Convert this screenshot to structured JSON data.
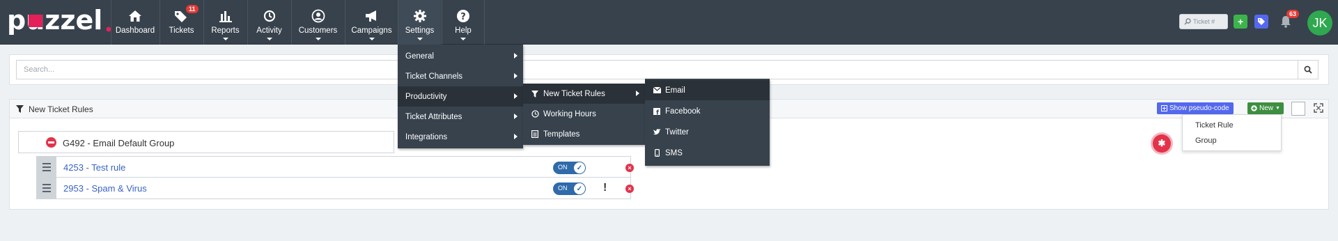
{
  "app": {
    "logo_text": "puzzel"
  },
  "nav": {
    "items": [
      {
        "label": "Dashboard",
        "icon": "home-icon"
      },
      {
        "label": "Tickets",
        "icon": "tags-icon",
        "badge": "11"
      },
      {
        "label": "Reports",
        "icon": "bar-chart-icon"
      },
      {
        "label": "Activity",
        "icon": "history-icon"
      },
      {
        "label": "Customers",
        "icon": "user-circle-icon"
      },
      {
        "label": "Campaigns",
        "icon": "bullhorn-icon"
      },
      {
        "label": "Settings",
        "icon": "gear-icon"
      },
      {
        "label": "Help",
        "icon": "question-icon"
      }
    ],
    "ticket_search_placeholder": "Ticket #",
    "notification_count": "63",
    "avatar_initials": "JK"
  },
  "search": {
    "placeholder": "Search..."
  },
  "rules_panel": {
    "title": "New Ticket Rules",
    "pseudo_code_label": "Show pseudo-code",
    "new_label": "New",
    "group_label": "G492 - Email Default Group",
    "rules": [
      {
        "label": "4253 - Test rule",
        "toggle": "ON",
        "warning": false
      },
      {
        "label": "2953 - Spam & Virus",
        "toggle": "ON",
        "warning": true,
        "warning_text": "!"
      }
    ]
  },
  "settings_menu": {
    "items": [
      "General",
      "Ticket Channels",
      "Productivity",
      "Ticket Attributes",
      "Integrations"
    ]
  },
  "productivity_menu": {
    "items": [
      "New Ticket Rules",
      "Working Hours",
      "Templates"
    ]
  },
  "channels_menu": {
    "items": [
      "Email",
      "Facebook",
      "Twitter",
      "SMS"
    ]
  },
  "new_dropdown": {
    "items": [
      "Ticket Rule",
      "Group"
    ]
  }
}
